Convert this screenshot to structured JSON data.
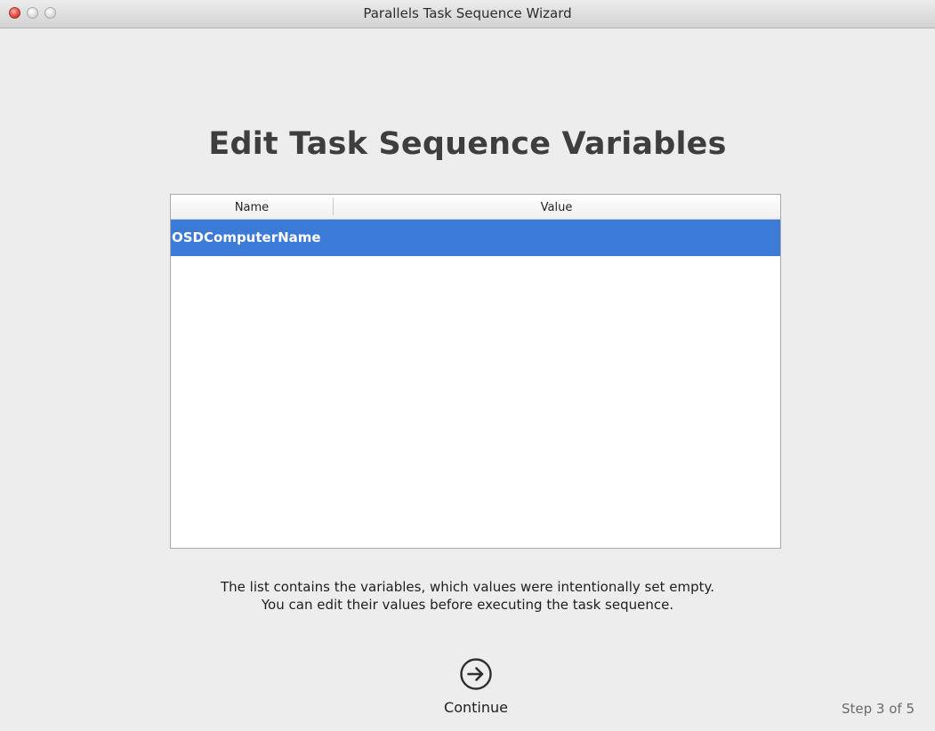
{
  "window": {
    "title": "Parallels Task Sequence Wizard"
  },
  "main": {
    "heading": "Edit Task Sequence Variables",
    "table": {
      "columns": [
        "Name",
        "Value"
      ],
      "rows": [
        {
          "name": "OSDComputerName",
          "value": "",
          "selected": true
        }
      ]
    },
    "description_line1": "The list contains the variables, which values were intentionally set empty.",
    "description_line2": "You can edit their values before executing the task sequence."
  },
  "footer": {
    "continue_label": "Continue",
    "continue_icon": "arrow-right-circle-icon",
    "step": "Step 3 of 5"
  },
  "colors": {
    "selection": "#3b7ad6",
    "background": "#ededed"
  }
}
